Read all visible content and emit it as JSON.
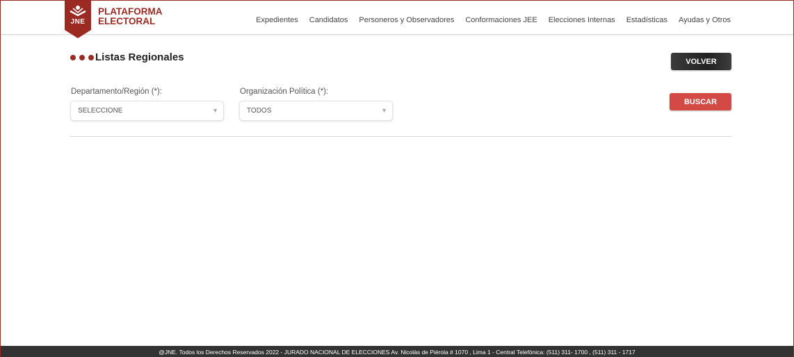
{
  "brand": {
    "badge_text": "JNE",
    "line1": "PLATAFORMA",
    "line2": "ELECTORAL",
    "color": "#9b2a23"
  },
  "nav": {
    "items": [
      "Expedientes",
      "Candidatos",
      "Personeros y Observadores",
      "Conformaciones JEE",
      "Elecciones Internas",
      "Estadísticas",
      "Ayudas y Otros"
    ]
  },
  "page": {
    "title": "Listas Regionales"
  },
  "buttons": {
    "volver": "VOLVER",
    "buscar": "BUSCAR"
  },
  "filters": {
    "departamento": {
      "label": "Departamento/Región (*):",
      "value": "SELECCIONE",
      "icon": "triangle-down-icon"
    },
    "organizacion": {
      "label": "Organización Política (*):",
      "value": "TODOS",
      "icon": "triangle-down-icon"
    }
  },
  "footer": {
    "text": "@JNE. Todos los Derechos Reservados 2022  -  JURADO NACIONAL DE ELECCIONES Av. Nicolás de Piérola # 1070 , Lima 1 - Central Telefónica: (511) 311- 1700 , (511) 311 - 1717"
  },
  "colors": {
    "accent": "#9b2a23",
    "buscar": "#d34a45",
    "volver": "#2b2b2b",
    "footer": "#333333"
  }
}
